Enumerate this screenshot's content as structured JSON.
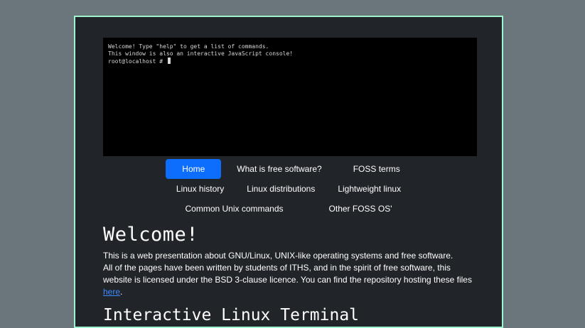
{
  "terminal": {
    "lines": [
      "Welcome! Type \"help\" to get a list of commands.",
      "This window is also an interactive JavaScript console!",
      "root@localhost # "
    ]
  },
  "nav": {
    "row1": [
      "Home",
      "What is free software?",
      "FOSS terms"
    ],
    "row2": [
      "Linux history",
      "Linux distributions",
      "Lightweight linux"
    ],
    "row3": [
      "Common Unix commands",
      "Other FOSS OS'"
    ],
    "active": "Home"
  },
  "content": {
    "heading": "Welcome!",
    "paragraph_line1": "This is a web presentation about GNU/Linux, UNIX-like operating systems and free software.",
    "paragraph_line2": "All of the pages have been written by students of ITHS, and in the spirit of free software, this website is licensed under the BSD 3-clause licence. You can find the repository hosting these files ",
    "link_text": "here",
    "paragraph_end": ".",
    "subheading": "Interactive Linux Terminal"
  },
  "colors": {
    "page_bg": "#6b757c",
    "container_bg": "#212428",
    "container_border": "#9ff3cf",
    "active_nav": "#0d6efd",
    "link": "#3d8bfd"
  }
}
